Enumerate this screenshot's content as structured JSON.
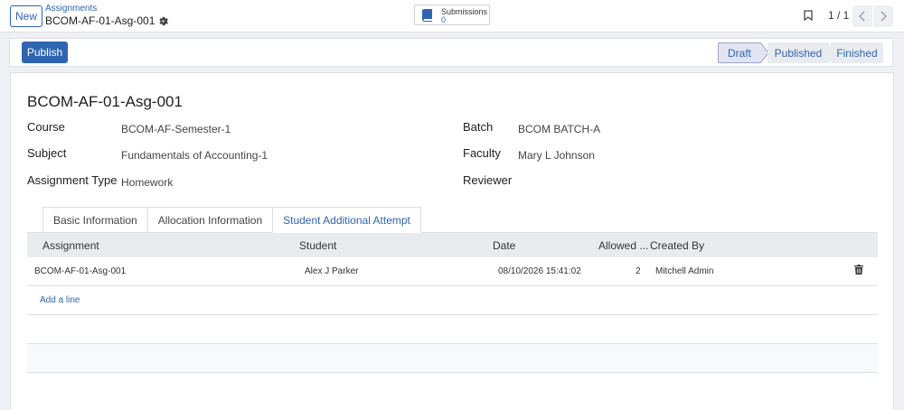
{
  "control_panel": {
    "new_label": "New",
    "breadcrumb_parent": "Assignments",
    "breadcrumb_current": "BCOM-AF-01-Asg-001",
    "smart_button": {
      "label": "Submissions",
      "count": "0"
    },
    "pager_value": "1 / 1"
  },
  "statusbar": {
    "publish_label": "Publish",
    "stages": [
      "Draft",
      "Published",
      "Finished"
    ],
    "current_stage": "Draft"
  },
  "record": {
    "title": "BCOM-AF-01-Asg-001",
    "fields": {
      "course": {
        "label": "Course",
        "value": "BCOM-AF-Semester-1"
      },
      "subject": {
        "label": "Subject",
        "value": "Fundamentals of Accounting-1"
      },
      "assignment_type": {
        "label": "Assignment Type",
        "value": "Homework"
      },
      "batch": {
        "label": "Batch",
        "value": "BCOM BATCH-A"
      },
      "faculty": {
        "label": "Faculty",
        "value": "Mary L Johnson"
      },
      "reviewer": {
        "label": "Reviewer",
        "value": ""
      }
    }
  },
  "tabs": [
    "Basic Information",
    "Allocation Information",
    "Student Additional Attempt"
  ],
  "active_tab": "Student Additional Attempt",
  "attempts_table": {
    "columns": [
      "Assignment",
      "Student",
      "Date",
      "Allowed ...",
      "Created By"
    ],
    "rows": [
      {
        "assignment": "BCOM-AF-01-Asg-001",
        "student": "Alex J Parker",
        "date": "08/10/2026 15:41:02",
        "allowed": "2",
        "created_by": "Mitchell Admin"
      }
    ],
    "add_line_label": "Add a line"
  },
  "colors": {
    "accent": "#2f64b1",
    "stage_active_bg": "#e2e4f2",
    "header_bg": "#e9ecef"
  },
  "icons": [
    "gear-icon",
    "book-icon",
    "bookmark-icon",
    "chevron-left-icon",
    "chevron-right-icon",
    "trash-icon"
  ]
}
